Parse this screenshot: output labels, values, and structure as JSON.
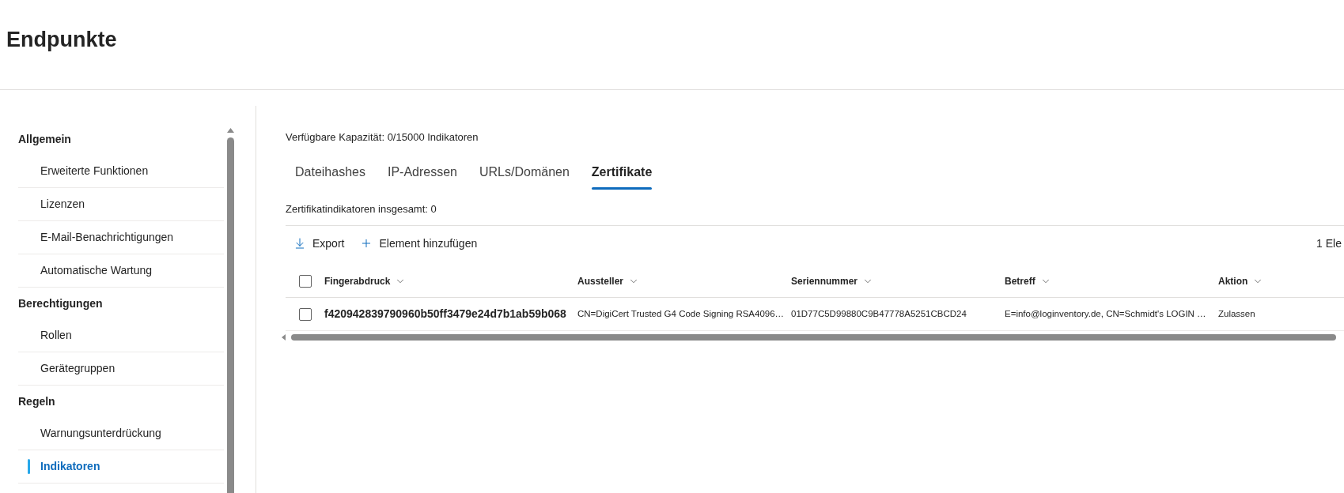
{
  "page": {
    "title": "Endpunkte"
  },
  "sidebar": {
    "sections": [
      {
        "title": "Allgemein",
        "items": [
          {
            "label": "Erweiterte Funktionen",
            "selected": false
          },
          {
            "label": "Lizenzen",
            "selected": false
          },
          {
            "label": "E-Mail-Benachrichtigungen",
            "selected": false
          },
          {
            "label": "Automatische Wartung",
            "selected": false
          }
        ]
      },
      {
        "title": "Berechtigungen",
        "items": [
          {
            "label": "Rollen",
            "selected": false
          },
          {
            "label": "Gerätegruppen",
            "selected": false
          }
        ]
      },
      {
        "title": "Regeln",
        "items": [
          {
            "label": "Warnungsunterdrückung",
            "selected": false
          },
          {
            "label": "Indikatoren",
            "selected": true
          }
        ]
      }
    ]
  },
  "main": {
    "capacity": "Verfügbare Kapazität: 0/15000 Indikatoren",
    "tabs": [
      {
        "label": "Dateihashes",
        "selected": false
      },
      {
        "label": "IP-Adressen",
        "selected": false
      },
      {
        "label": "URLs/Domänen",
        "selected": false
      },
      {
        "label": "Zertifikate",
        "selected": true
      }
    ],
    "total": "Zertifikatindikatoren insgesamt: 0",
    "toolbar": [
      {
        "kind": "export",
        "label": "Export"
      },
      {
        "kind": "add",
        "label": "Element hinzufügen"
      }
    ],
    "item_count": "1 Ele",
    "table": {
      "select_all": {
        "checked": false
      },
      "columns": [
        "Fingerabdruck",
        "Aussteller",
        "Seriennummer",
        "Betreff",
        "Aktion"
      ],
      "rows": [
        {
          "checked": false,
          "cells": [
            "f420942839790960b50ff3479e24d7b1ab59b068",
            "CN=DigiCert Trusted G4 Code Signing RSA4096…",
            "01D77C5D99880C9B47778A5251CBCD24",
            "E=info@loginventory.de, CN=Schmidt's LOGIN …",
            "Zulassen"
          ]
        }
      ]
    }
  }
}
